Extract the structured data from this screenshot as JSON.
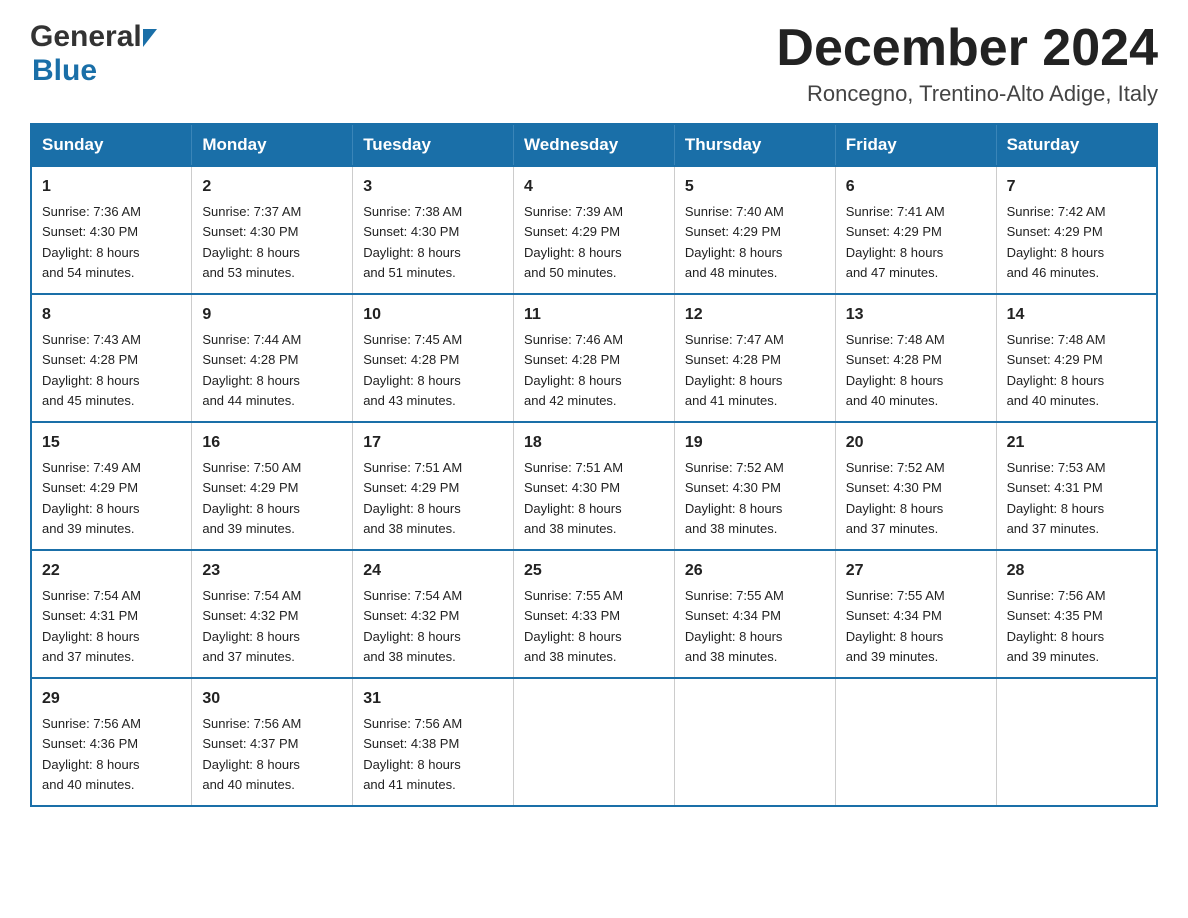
{
  "header": {
    "logo_general": "General",
    "logo_blue": "Blue",
    "month_title": "December 2024",
    "subtitle": "Roncegno, Trentino-Alto Adige, Italy"
  },
  "days_of_week": [
    "Sunday",
    "Monday",
    "Tuesday",
    "Wednesday",
    "Thursday",
    "Friday",
    "Saturday"
  ],
  "weeks": [
    [
      {
        "day": "1",
        "sunrise": "7:36 AM",
        "sunset": "4:30 PM",
        "daylight": "8 hours and 54 minutes."
      },
      {
        "day": "2",
        "sunrise": "7:37 AM",
        "sunset": "4:30 PM",
        "daylight": "8 hours and 53 minutes."
      },
      {
        "day": "3",
        "sunrise": "7:38 AM",
        "sunset": "4:30 PM",
        "daylight": "8 hours and 51 minutes."
      },
      {
        "day": "4",
        "sunrise": "7:39 AM",
        "sunset": "4:29 PM",
        "daylight": "8 hours and 50 minutes."
      },
      {
        "day": "5",
        "sunrise": "7:40 AM",
        "sunset": "4:29 PM",
        "daylight": "8 hours and 48 minutes."
      },
      {
        "day": "6",
        "sunrise": "7:41 AM",
        "sunset": "4:29 PM",
        "daylight": "8 hours and 47 minutes."
      },
      {
        "day": "7",
        "sunrise": "7:42 AM",
        "sunset": "4:29 PM",
        "daylight": "8 hours and 46 minutes."
      }
    ],
    [
      {
        "day": "8",
        "sunrise": "7:43 AM",
        "sunset": "4:28 PM",
        "daylight": "8 hours and 45 minutes."
      },
      {
        "day": "9",
        "sunrise": "7:44 AM",
        "sunset": "4:28 PM",
        "daylight": "8 hours and 44 minutes."
      },
      {
        "day": "10",
        "sunrise": "7:45 AM",
        "sunset": "4:28 PM",
        "daylight": "8 hours and 43 minutes."
      },
      {
        "day": "11",
        "sunrise": "7:46 AM",
        "sunset": "4:28 PM",
        "daylight": "8 hours and 42 minutes."
      },
      {
        "day": "12",
        "sunrise": "7:47 AM",
        "sunset": "4:28 PM",
        "daylight": "8 hours and 41 minutes."
      },
      {
        "day": "13",
        "sunrise": "7:48 AM",
        "sunset": "4:28 PM",
        "daylight": "8 hours and 40 minutes."
      },
      {
        "day": "14",
        "sunrise": "7:48 AM",
        "sunset": "4:29 PM",
        "daylight": "8 hours and 40 minutes."
      }
    ],
    [
      {
        "day": "15",
        "sunrise": "7:49 AM",
        "sunset": "4:29 PM",
        "daylight": "8 hours and 39 minutes."
      },
      {
        "day": "16",
        "sunrise": "7:50 AM",
        "sunset": "4:29 PM",
        "daylight": "8 hours and 39 minutes."
      },
      {
        "day": "17",
        "sunrise": "7:51 AM",
        "sunset": "4:29 PM",
        "daylight": "8 hours and 38 minutes."
      },
      {
        "day": "18",
        "sunrise": "7:51 AM",
        "sunset": "4:30 PM",
        "daylight": "8 hours and 38 minutes."
      },
      {
        "day": "19",
        "sunrise": "7:52 AM",
        "sunset": "4:30 PM",
        "daylight": "8 hours and 38 minutes."
      },
      {
        "day": "20",
        "sunrise": "7:52 AM",
        "sunset": "4:30 PM",
        "daylight": "8 hours and 37 minutes."
      },
      {
        "day": "21",
        "sunrise": "7:53 AM",
        "sunset": "4:31 PM",
        "daylight": "8 hours and 37 minutes."
      }
    ],
    [
      {
        "day": "22",
        "sunrise": "7:54 AM",
        "sunset": "4:31 PM",
        "daylight": "8 hours and 37 minutes."
      },
      {
        "day": "23",
        "sunrise": "7:54 AM",
        "sunset": "4:32 PM",
        "daylight": "8 hours and 37 minutes."
      },
      {
        "day": "24",
        "sunrise": "7:54 AM",
        "sunset": "4:32 PM",
        "daylight": "8 hours and 38 minutes."
      },
      {
        "day": "25",
        "sunrise": "7:55 AM",
        "sunset": "4:33 PM",
        "daylight": "8 hours and 38 minutes."
      },
      {
        "day": "26",
        "sunrise": "7:55 AM",
        "sunset": "4:34 PM",
        "daylight": "8 hours and 38 minutes."
      },
      {
        "day": "27",
        "sunrise": "7:55 AM",
        "sunset": "4:34 PM",
        "daylight": "8 hours and 39 minutes."
      },
      {
        "day": "28",
        "sunrise": "7:56 AM",
        "sunset": "4:35 PM",
        "daylight": "8 hours and 39 minutes."
      }
    ],
    [
      {
        "day": "29",
        "sunrise": "7:56 AM",
        "sunset": "4:36 PM",
        "daylight": "8 hours and 40 minutes."
      },
      {
        "day": "30",
        "sunrise": "7:56 AM",
        "sunset": "4:37 PM",
        "daylight": "8 hours and 40 minutes."
      },
      {
        "day": "31",
        "sunrise": "7:56 AM",
        "sunset": "4:38 PM",
        "daylight": "8 hours and 41 minutes."
      },
      null,
      null,
      null,
      null
    ]
  ],
  "labels": {
    "sunrise": "Sunrise:",
    "sunset": "Sunset:",
    "daylight": "Daylight:"
  },
  "colors": {
    "header_bg": "#1a6fa8",
    "header_text": "#ffffff",
    "border": "#1a6fa8"
  }
}
